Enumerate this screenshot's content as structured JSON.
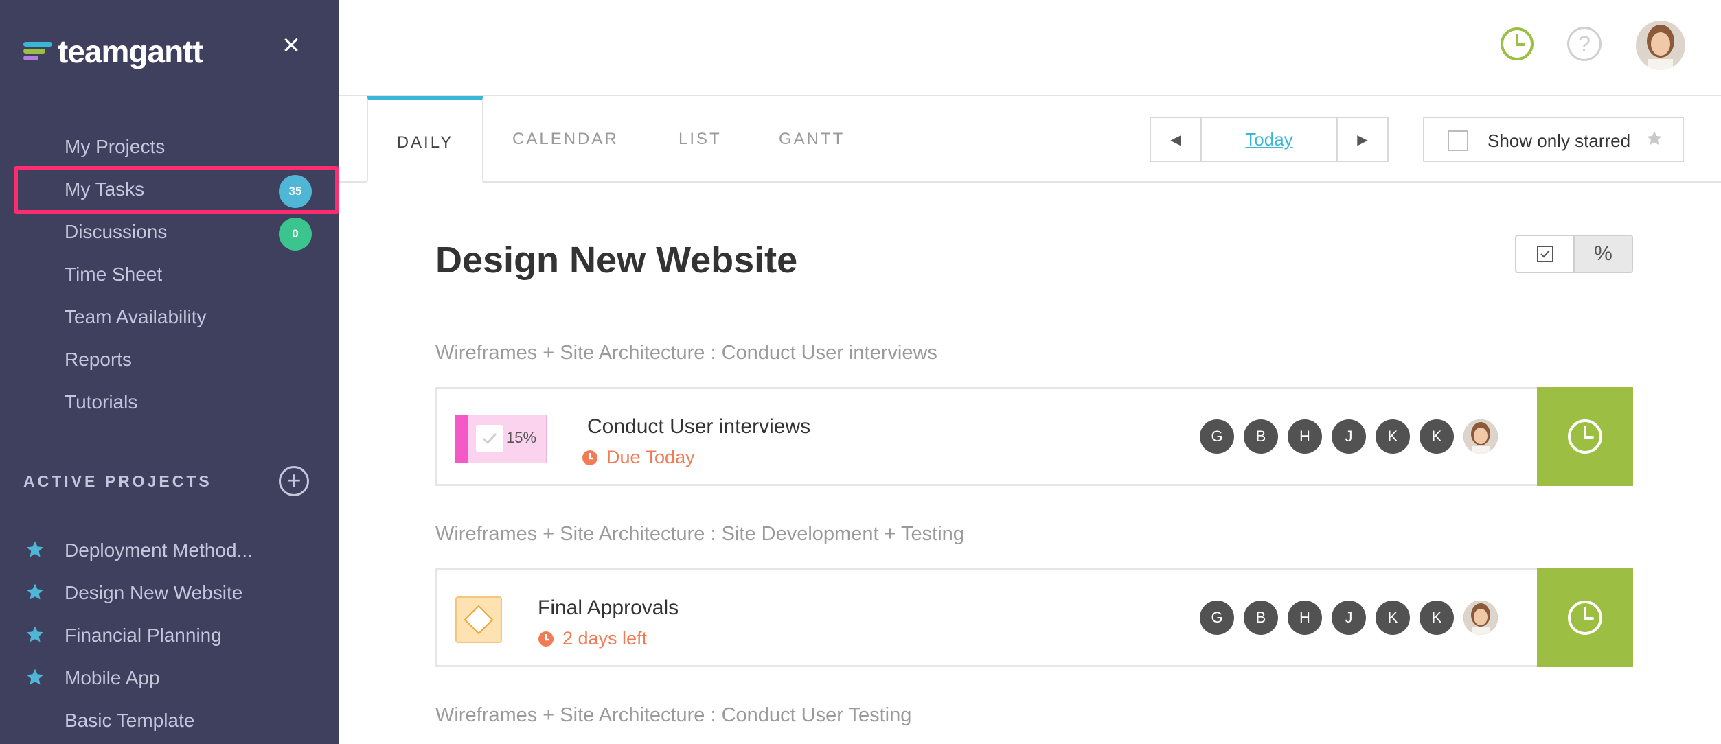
{
  "brand": {
    "name": "teamgantt"
  },
  "sidebar": {
    "nav": [
      {
        "label": "My Projects"
      },
      {
        "label": "My Tasks",
        "badge": "35"
      },
      {
        "label": "Discussions",
        "badge": "0"
      },
      {
        "label": "Time Sheet"
      },
      {
        "label": "Team Availability"
      },
      {
        "label": "Reports"
      },
      {
        "label": "Tutorials"
      }
    ],
    "active_projects_title": "ACTIVE PROJECTS",
    "projects": [
      {
        "label": "Deployment Method...",
        "starred": true
      },
      {
        "label": "Design New Website",
        "starred": true
      },
      {
        "label": "Financial Planning",
        "starred": true
      },
      {
        "label": "Mobile App",
        "starred": true
      },
      {
        "label": "Basic Template",
        "starred": false
      }
    ]
  },
  "tabs": [
    {
      "label": "DAILY",
      "active": true
    },
    {
      "label": "CALENDAR",
      "active": false
    },
    {
      "label": "LIST",
      "active": false
    },
    {
      "label": "GANTT",
      "active": false
    }
  ],
  "date_nav": {
    "today_label": "Today"
  },
  "filter": {
    "starred_label": "Show only starred",
    "checked": false
  },
  "main": {
    "project_title": "Design New Website",
    "groups": [
      {
        "label": "Wireframes + Site Architecture : Conduct User interviews",
        "task": {
          "name": "Conduct User interviews",
          "due": "Due Today",
          "progress": "15%",
          "assignees": [
            "G",
            "B",
            "H",
            "J",
            "K",
            "K"
          ]
        }
      },
      {
        "label": "Wireframes + Site Architecture : Site Development + Testing",
        "task": {
          "name": "Final Approvals",
          "due": "2 days left",
          "assignees": [
            "G",
            "B",
            "H",
            "J",
            "K",
            "K"
          ]
        }
      },
      {
        "label": "Wireframes + Site Architecture : Conduct User Testing"
      }
    ]
  },
  "colors": {
    "sidebar_bg": "#3f3f5e",
    "accent_blue": "#3ab7d6",
    "accent_green": "#9cbf43",
    "badge_blue": "#4fb6d6",
    "badge_green": "#3cc48f",
    "highlight": "#ff2d6f",
    "due_orange": "#f07b55"
  }
}
